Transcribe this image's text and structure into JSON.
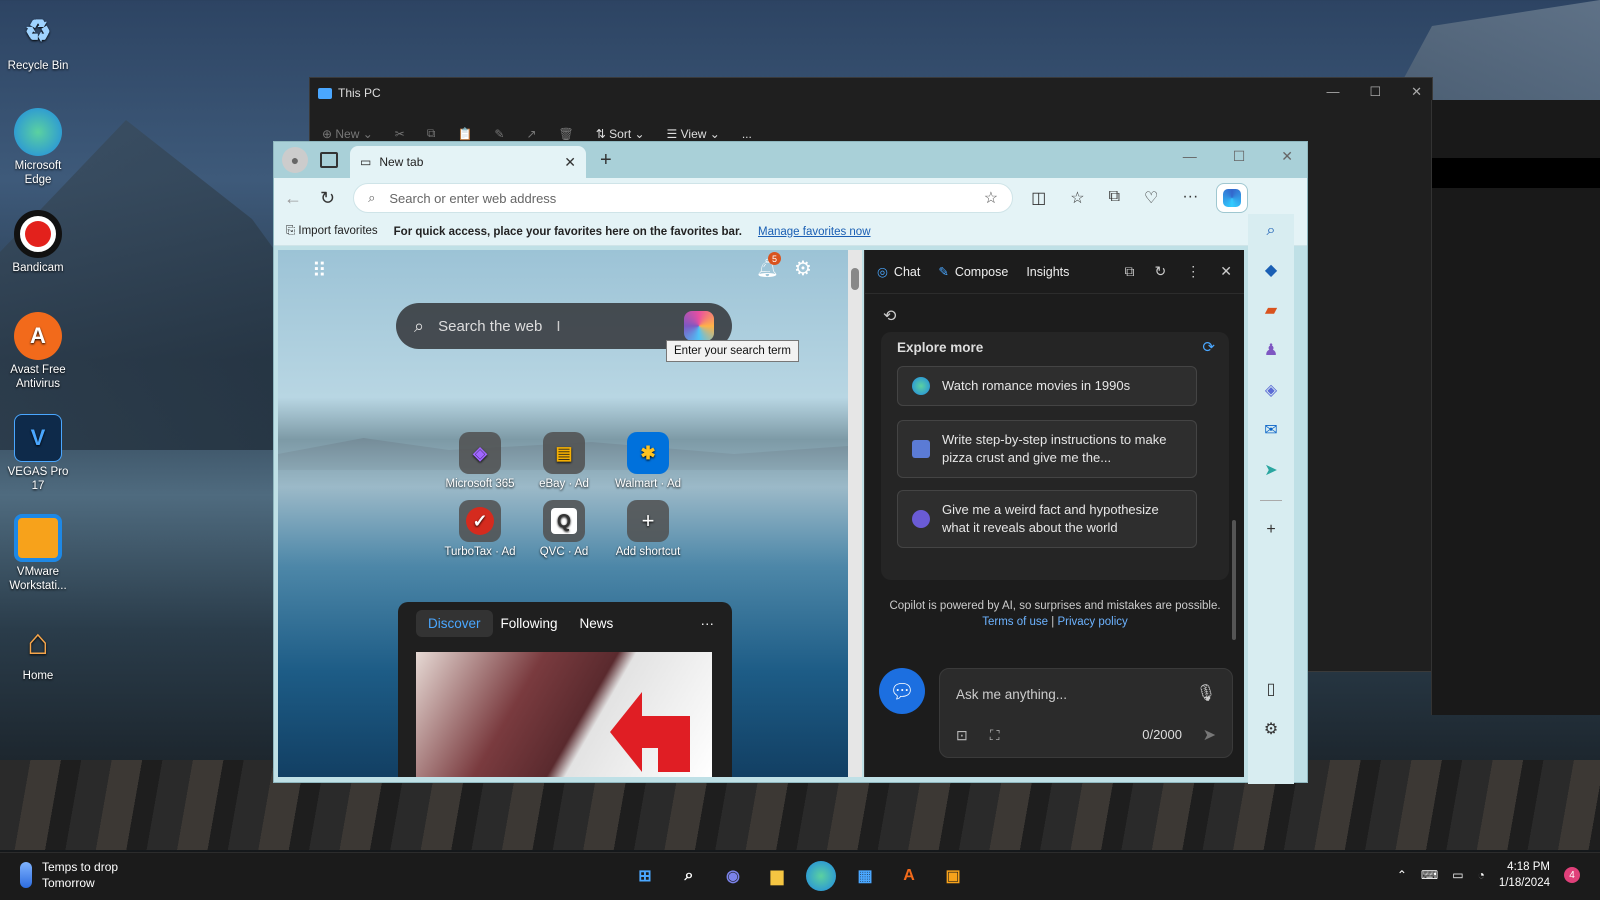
{
  "desktop": {
    "icons": [
      {
        "label": "Recycle Bin"
      },
      {
        "label": "Microsoft Edge"
      },
      {
        "label": "Bandicam"
      },
      {
        "label": "Avast Free Antivirus"
      },
      {
        "label": "VEGAS Pro 17"
      },
      {
        "label": "VMware Workstati..."
      },
      {
        "label": "Home"
      }
    ]
  },
  "explorer": {
    "title": "This PC",
    "toolbar": {
      "new": "New",
      "sort": "Sort",
      "view": "View",
      "more": "..."
    }
  },
  "edge": {
    "tab_title": "New tab",
    "address_placeholder": "Search or enter web address",
    "favbar": {
      "import": "Import favorites",
      "hint": "For quick access, place your favorites here on the favorites bar.",
      "manage": "Manage favorites now"
    },
    "ntp": {
      "notification_count": "5",
      "search_placeholder": "Search the web",
      "tooltip": "Enter your search term",
      "shortcuts": [
        {
          "label": "Microsoft 365",
          "icon": "m365-icon"
        },
        {
          "label": "eBay · Ad",
          "icon": "ebay-icon"
        },
        {
          "label": "Walmart · Ad",
          "icon": "walmart-icon"
        },
        {
          "label": "TurboTax · Ad",
          "icon": "turbotax-icon"
        },
        {
          "label": "QVC · Ad",
          "icon": "qvc-icon"
        },
        {
          "label": "Add shortcut",
          "icon": "plus-icon"
        }
      ],
      "feed_tabs": {
        "discover": "Discover",
        "following": "Following",
        "news": "News",
        "more": "···"
      }
    },
    "copilot": {
      "tabs": {
        "chat": "Chat",
        "compose": "Compose",
        "insights": "Insights"
      },
      "explore_title": "Explore more",
      "suggestions": [
        "Watch romance movies in 1990s",
        "Write step-by-step instructions to make pizza crust and give me the...",
        "Give me a weird fact and hypothesize what it reveals about the world"
      ],
      "disclaimer": "Copilot is powered by AI, so surprises and mistakes are possible.",
      "terms": "Terms of use",
      "sep": "|",
      "privacy": "Privacy policy",
      "ask_placeholder": "Ask me anything...",
      "counter": "0/2000"
    }
  },
  "taskbar": {
    "weather_line1": "Temps to drop",
    "weather_line2": "Tomorrow",
    "time": "4:18 PM",
    "date": "1/18/2024",
    "notification_count": "4"
  }
}
